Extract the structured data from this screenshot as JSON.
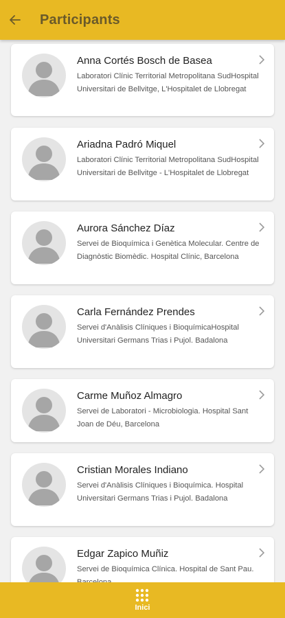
{
  "header": {
    "title": "Participants"
  },
  "participants": [
    {
      "name": "Anna Cortés Bosch de Basea",
      "affiliation": " Laboratori Clínic Territorial Metropolitana SudHospital Universitari de Bellvitge, L'Hospitalet de Llobregat"
    },
    {
      "name": "Ariadna Padró Miquel",
      "affiliation": " Laboratori Clínic Territorial Metropolitana SudHospital Universitari de Bellvitge - L'Hospitalet de Llobregat"
    },
    {
      "name": "Aurora Sánchez Díaz",
      "affiliation": " Servei de Bioquímica i Genètica Molecular. Centre de Diagnòstic Biomèdic. Hospital Clínic, Barcelona"
    },
    {
      "name": "Carla Fernández Prendes",
      "affiliation": " Servei d'Anàlisis Clíniques i BioquímicaHospital Universitari Germans Trias i Pujol. Badalona"
    },
    {
      "name": "Carme Muñoz Almagro",
      "affiliation": " Servei de Laboratori - Microbiologia. Hospital Sant Joan de Déu, Barcelona"
    },
    {
      "name": "Cristian Morales Indiano",
      "affiliation": " Servei d'Anàlisis Clíniques i Bioquímica. Hospital Universitari Germans Trias i Pujol. Badalona"
    },
    {
      "name": "Edgar Zapico Muñiz",
      "affiliation": " Servei de Bioquímica Clínica. Hospital de Sant Pau. Barcelona"
    }
  ],
  "footer": {
    "tab_label": "Inici"
  },
  "icons": {
    "back": "arrow-left-icon",
    "chevron": "chevron-right-icon",
    "avatar": "user-placeholder-icon",
    "home": "grid-icon"
  },
  "colors": {
    "accent": "#e8b923",
    "title_text": "#6a5a2a",
    "background": "#f1f1f1"
  }
}
